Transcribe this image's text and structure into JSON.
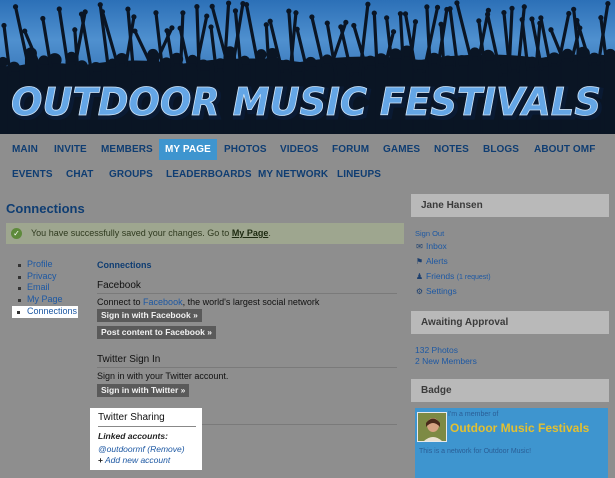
{
  "banner": {
    "title": "OUTDOOR MUSIC FESTIVALS"
  },
  "nav": {
    "row1": [
      "MAIN",
      "INVITE",
      "MEMBERS",
      "MY PAGE",
      "PHOTOS",
      "VIDEOS",
      "FORUM",
      "GAMES",
      "NOTES",
      "BLOGS",
      "ABOUT OMF"
    ],
    "row2": [
      "EVENTS",
      "CHAT",
      "GROUPS",
      "LEADERBOARDS",
      "MY NETWORK",
      "LINEUPS"
    ],
    "active": "MY PAGE"
  },
  "page": {
    "title": "Connections",
    "success_message": "You have successfully saved your changes. Go to",
    "success_link": "My Page",
    "success_suffix": "."
  },
  "settings_nav": {
    "items": [
      "Profile",
      "Privacy",
      "Email",
      "My Page",
      "Connections"
    ],
    "current": "Connections"
  },
  "connections": {
    "heading": "Connections",
    "facebook": {
      "heading": "Facebook",
      "desc_prefix": "Connect to",
      "desc_link": "Facebook",
      "desc_suffix": ", the world's largest social network",
      "sign_in_button": "Sign in with Facebook »",
      "post_button": "Post content to Facebook »"
    },
    "twitter_sign_in": {
      "heading": "Twitter Sign In",
      "desc": "Sign in with your Twitter account.",
      "button": "Sign in with Twitter »"
    },
    "twitter_sharing": {
      "heading": "Twitter Sharing",
      "linked_label": "Linked accounts:",
      "linked_account": "@outdoormf (Remove)",
      "add_account": "Add new account"
    }
  },
  "sidebar": {
    "user": {
      "name": "Jane Hansen",
      "sign_out": "Sign Out",
      "inbox": "Inbox",
      "alerts": "Alerts",
      "friends": "Friends",
      "friends_requests": "(1 request)",
      "settings": "Settings"
    },
    "awaiting": {
      "heading": "Awaiting Approval",
      "photos": "132 Photos",
      "members": "2 New Members"
    },
    "badge": {
      "heading": "Badge",
      "caption": "I'm a member of",
      "title": "Outdoor Music Festivals",
      "desc": "This is a network for Outdoor Music!"
    }
  },
  "colors": {
    "accent_blue": "#3e95cf",
    "link_blue": "#1d58a3",
    "nav_text": "#0f3d72",
    "badge_title": "#e2c032",
    "background": "#8e8e8e"
  }
}
